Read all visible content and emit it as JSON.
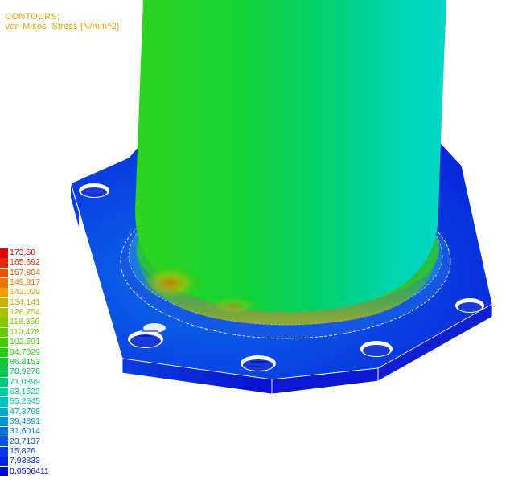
{
  "header": {
    "contour_label": "CONTOURS;",
    "result_label": "von Mises  Stress [N/mm^2]",
    "color": "#e8a300"
  },
  "legend": {
    "values": [
      "173,58",
      "165,692",
      "157,804",
      "149,917",
      "142,029",
      "134,141",
      "126,254",
      "118,366",
      "110,478",
      "102,591",
      "94,7029",
      "86,8153",
      "78,9276",
      "71,0399",
      "63,1522",
      "55,2645",
      "47,3768",
      "39,4891",
      "31,6014",
      "23,7137",
      "15,826",
      "7,93833",
      "0,0506411"
    ],
    "colors": [
      "#e00000",
      "#e22a00",
      "#e65200",
      "#ea7800",
      "#eda000",
      "#c6b400",
      "#a8c000",
      "#86c800",
      "#62cc00",
      "#40cc00",
      "#26cc10",
      "#10c830",
      "#00c850",
      "#00c878",
      "#00c8a0",
      "#00c0c0",
      "#00a8d0",
      "#0090dc",
      "#0074e4",
      "#0058e8",
      "#003ce8",
      "#0022e0",
      "#0008d8"
    ]
  },
  "bolt_hole_count": 8
}
